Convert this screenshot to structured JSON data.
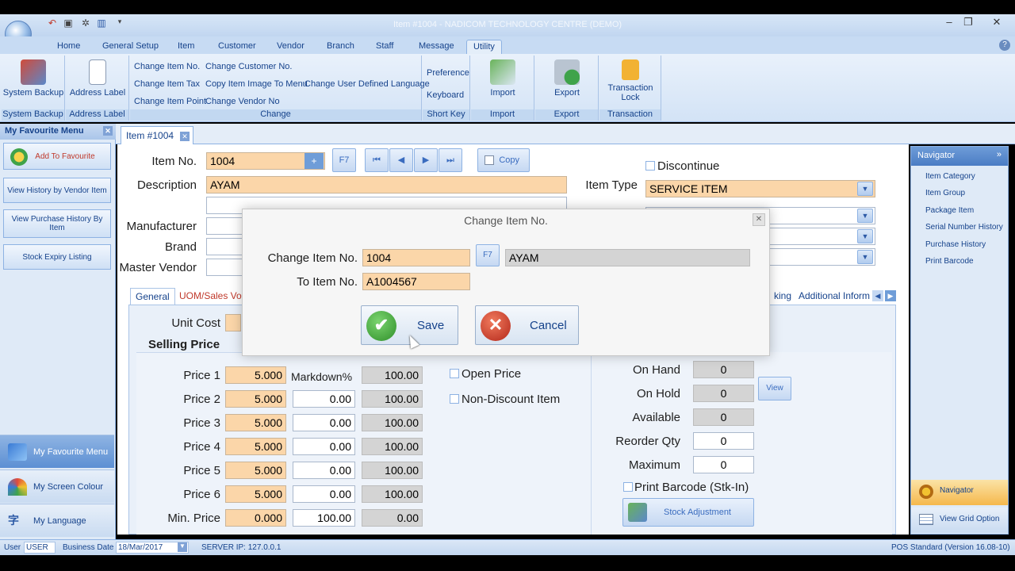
{
  "window": {
    "title": "Item #1004 - NADICOM TECHNOLOGY CENTRE (DEMO)",
    "controls": [
      "–",
      "❐",
      "✕"
    ]
  },
  "ribbon_tabs": [
    "Home",
    "General Setup",
    "Item",
    "Customer",
    "Vendor",
    "Branch",
    "Staff",
    "Message",
    "Utility"
  ],
  "ribbon": {
    "system_backup": "System Backup",
    "address_label": "Address Label",
    "change_group": {
      "items": [
        "Change Item No.",
        "Change Customer No.",
        "Change Item Tax",
        "Copy Item Image To Menu",
        "Change User Defined Language",
        "Change Item Point",
        "Change Vendor No"
      ],
      "label": "Change"
    },
    "preference": "Preference",
    "keyboard": "Keyboard",
    "short_key": "Short Key",
    "import": "Import",
    "export": "Export",
    "transaction_lock": "Transaction Lock",
    "transaction": "Transaction"
  },
  "left_pane": {
    "header": "My Favourite Menu",
    "add_favourite": "Add To Favourite",
    "buttons": [
      "View History by Vendor Item",
      "View Purchase History By Item",
      "Stock Expiry Listing"
    ],
    "nav": [
      "My Favourite Menu",
      "My Screen Colour",
      "My Language"
    ]
  },
  "doc_tab": "Item #1004",
  "item_form": {
    "item_no_label": "Item No.",
    "item_no": "1004",
    "description_label": "Description",
    "description": "AYAM",
    "manufacturer_label": "Manufacturer",
    "brand_label": "Brand",
    "master_vendor_label": "Master Vendor",
    "f7": "F7",
    "copy": "Copy",
    "discontinue": "Discontinue",
    "item_type_label": "Item Type",
    "item_type": "SERVICE ITEM",
    "tabs": [
      "General",
      "UOM/Sales Vol",
      "king",
      "Additional Inform"
    ],
    "unit_cost_label": "Unit Cost",
    "selling_price": "Selling Price",
    "markdown_label": "Markdown%",
    "prices": [
      {
        "label": "Price 1",
        "price": "5.000",
        "markdown": "",
        "pct": "100.00"
      },
      {
        "label": "Price 2",
        "price": "5.000",
        "markdown": "0.00",
        "pct": "100.00"
      },
      {
        "label": "Price 3",
        "price": "5.000",
        "markdown": "0.00",
        "pct": "100.00"
      },
      {
        "label": "Price 4",
        "price": "5.000",
        "markdown": "0.00",
        "pct": "100.00"
      },
      {
        "label": "Price 5",
        "price": "5.000",
        "markdown": "0.00",
        "pct": "100.00"
      },
      {
        "label": "Price 6",
        "price": "5.000",
        "markdown": "0.00",
        "pct": "100.00"
      },
      {
        "label": "Min. Price",
        "price": "0.000",
        "markdown": "100.00",
        "pct": "0.00"
      }
    ],
    "open_price": "Open Price",
    "non_discount": "Non-Discount Item",
    "stock": [
      {
        "label": "On Hand",
        "value": "0"
      },
      {
        "label": "On Hold",
        "value": "0"
      },
      {
        "label": "Available",
        "value": "0"
      },
      {
        "label": "Reorder Qty",
        "value": "0"
      },
      {
        "label": "Maximum",
        "value": "0"
      }
    ],
    "view": "View",
    "print_barcode": "Print Barcode (Stk-In)",
    "stock_adjustment": "Stock Adjustment"
  },
  "navigator": {
    "header": "Navigator",
    "links": [
      "Item Category",
      "Item Group",
      "Package Item",
      "Serial Number History",
      "Purchase History",
      "Print Barcode"
    ],
    "bottom": [
      "Navigator",
      "View Grid Option"
    ]
  },
  "dialog": {
    "title": "Change Item No.",
    "change_label": "Change Item No.",
    "change_value": "1004",
    "f7": "F7",
    "desc_value": "AYAM",
    "to_label": "To Item No.",
    "to_value": "A1004567",
    "save": "Save",
    "cancel": "Cancel"
  },
  "status": {
    "user_label": "User",
    "user": "USER",
    "date_label": "Business Date",
    "date": "18/Mar/2017",
    "server": "SERVER IP: 127.0.0.1",
    "version": "POS Standard (Version 16.08-10)"
  },
  "colors": {
    "orange_field": "#fbd6a9",
    "ribbon_blue": "#d3e3f6",
    "save_green": "#3ea83a",
    "cancel_red": "#d0321f"
  }
}
